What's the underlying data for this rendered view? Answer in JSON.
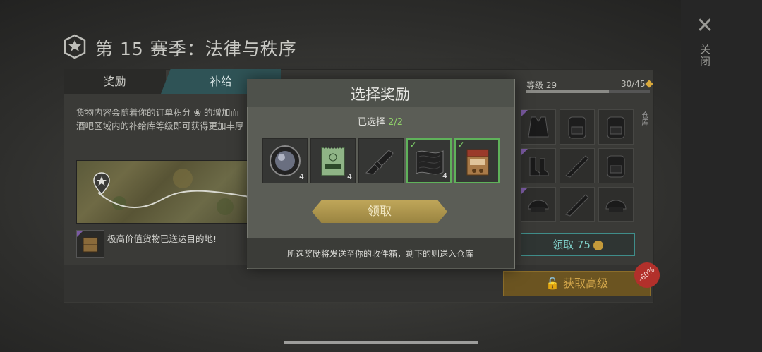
{
  "header": {
    "title": "第 15 赛季：法律与秩序",
    "close_label": "关闭"
  },
  "tabs": [
    {
      "label": "奖励"
    },
    {
      "label": "补给"
    }
  ],
  "supply_panel": {
    "description_lines": [
      "货物内容会随着你的订单积分 ❀ 的增加而",
      "酒吧区域内的补给库等级即可获得更加丰厚"
    ],
    "delivery_note": "极高价值货物已送达目的地!"
  },
  "level_panel": {
    "level_label": "等级 29",
    "progress_text": "30/45",
    "progress_fraction": 0.67,
    "storage_label": "仓库",
    "claim_label": "领取",
    "claim_cost": "75",
    "premium_label": "获取高级",
    "discount": "-60%"
  },
  "modal": {
    "title": "选择奖励",
    "selected_prefix": "已选择 ",
    "selected_count": "2/2",
    "confirm_label": "领取",
    "footer_text": "所选奖励将发送至你的收件箱，剩下的则送入仓库",
    "rewards": [
      {
        "icon": "lens-icon",
        "qty": "4",
        "selected": false
      },
      {
        "icon": "notebook-icon",
        "qty": "4",
        "selected": false
      },
      {
        "icon": "rifle-icon",
        "qty": "",
        "selected": false
      },
      {
        "icon": "armor-plate-icon",
        "qty": "4",
        "selected": true
      },
      {
        "icon": "bar-counter-icon",
        "qty": "",
        "selected": true
      }
    ]
  },
  "colors": {
    "accent_green": "#5fb25a",
    "teal_tab": "#2f5356",
    "gold_button": "#bfa659",
    "premium_gold": "#d1a54a"
  }
}
